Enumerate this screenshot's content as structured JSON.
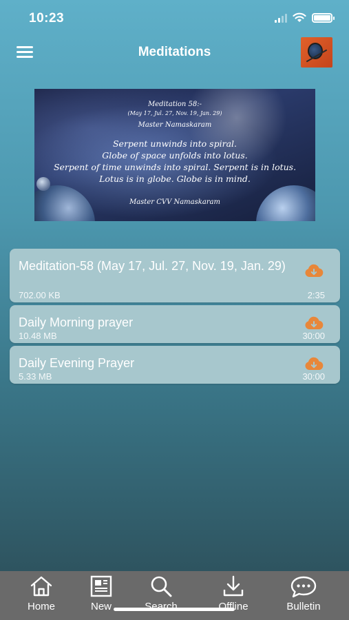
{
  "status_bar": {
    "time": "10:23"
  },
  "header": {
    "title": "Meditations"
  },
  "banner": {
    "lines": [
      "Meditation 58:-",
      "(May 17, Jul. 27, Nov. 19, Jan. 29)",
      "Master Namaskaram",
      "Serpent unwinds into spiral.",
      "Globe of space unfolds into lotus.",
      "Serpent of time unwinds into spiral. Serpent is in lotus.",
      "Lotus is in globe. Globe is in mind.",
      "Master CVV Namaskaram"
    ]
  },
  "tracks": [
    {
      "title": "Meditation-58 (May 17, Jul. 27, Nov. 19, Jan. 29)",
      "size": "702.00 KB",
      "duration": "2:35"
    },
    {
      "title": "Daily Morning prayer",
      "size": "10.48 MB",
      "duration": "30:00"
    },
    {
      "title": "Daily Evening Prayer",
      "size": "5.33 MB",
      "duration": "30:00"
    }
  ],
  "tab_bar": {
    "tabs": [
      {
        "label": "Home",
        "icon": "home-icon"
      },
      {
        "label": "New",
        "icon": "newspaper-icon"
      },
      {
        "label": "Search",
        "icon": "search-icon"
      },
      {
        "label": "Offline",
        "icon": "download-icon"
      },
      {
        "label": "Bulletin",
        "icon": "chat-bubble-icon"
      }
    ]
  },
  "colors": {
    "accent_orange": "#e8873a",
    "card": "#a7c7cd",
    "tab_bar": "#6a6a6a"
  }
}
